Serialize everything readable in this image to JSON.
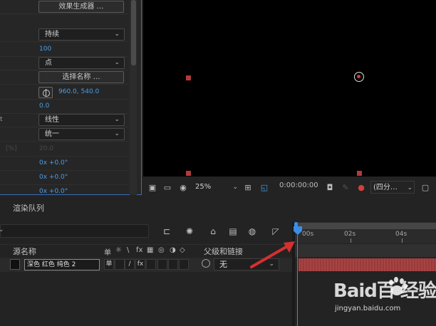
{
  "effect_controls": {
    "generator_button": "效果生成器 …",
    "duration_mode": "持续",
    "value_100": "100",
    "point_mode": "点",
    "choose_name_button": "选择名称 …",
    "position": "960.0, 540.0",
    "zero_value": "0.0",
    "linear_label_fragment": "t",
    "interpolation": "线性",
    "uniform": "统一",
    "percent_label_fragment": "[%]",
    "dim_value": "20.0",
    "rotation_1": "0x +0.0°",
    "rotation_2": "0x +0.0°",
    "rotation_3": "0x +0.0°"
  },
  "viewer_toolbar": {
    "zoom": "25%",
    "timecode": "0:00:00:00",
    "view_layout": "(四分…",
    "icons": [
      "snapshot-monitor-icon",
      "display-icon",
      "mask-icon",
      "grid-icon",
      "region-icon",
      "camera-icon",
      "channel-icon",
      "color-icon"
    ]
  },
  "panels": {
    "render_queue_tab": "渲染队列"
  },
  "timeline": {
    "header": {
      "source_name": "源名称",
      "parent_link": "父级和链接",
      "switch_symbols": [
        "单",
        "☼",
        "\\",
        "fx"
      ]
    },
    "layer": {
      "name": "深色 红色 纯色 2",
      "parent_value": "无",
      "switch_1": "单",
      "switch_2": "/",
      "switch_3": "fx"
    },
    "ruler_labels": [
      "00s",
      "02s",
      "04s"
    ]
  },
  "watermark": {
    "logo": "Baid百 经验",
    "url": "jingyan.baidu.com"
  },
  "colors": {
    "accent": "#3a8ee6",
    "layer_bar": "#a33d3d",
    "handle": "#b23a3a",
    "value_blue": "#4a9fe8"
  }
}
